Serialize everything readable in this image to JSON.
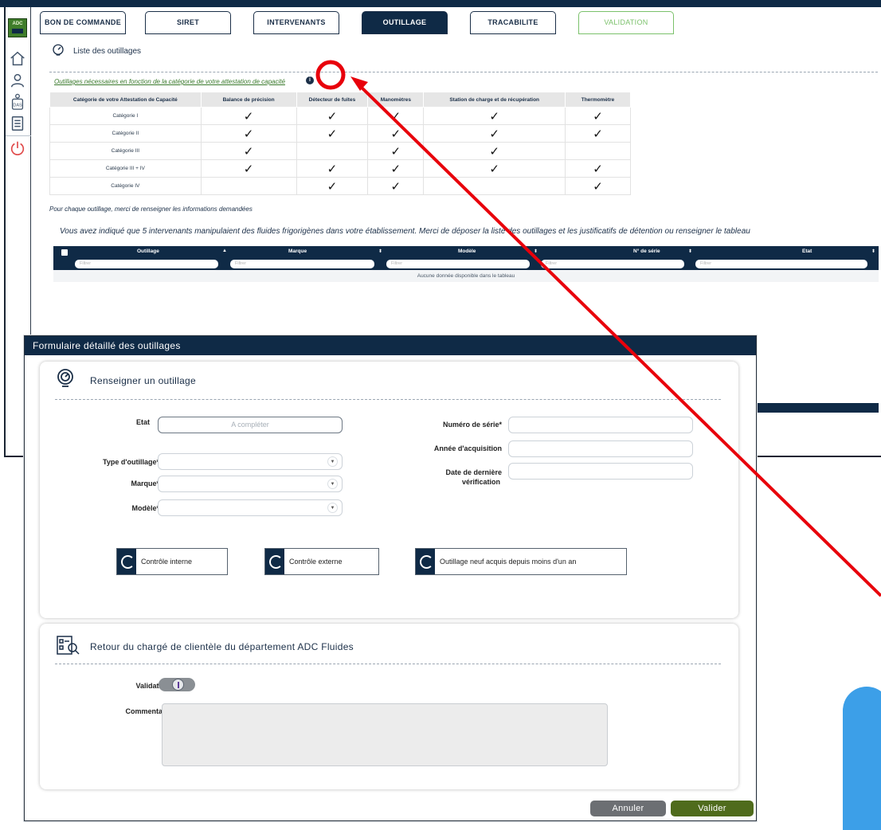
{
  "sidebar": {
    "logo_text": "ADC",
    "items": [
      {
        "name": "home"
      },
      {
        "name": "user"
      },
      {
        "name": "users-bag",
        "badge": "DAS"
      },
      {
        "name": "document"
      },
      {
        "name": "power"
      }
    ]
  },
  "tabs": [
    {
      "label": "BON DE COMMANDE",
      "active": false
    },
    {
      "label": "SIRET",
      "active": false
    },
    {
      "label": "INTERVENANTS",
      "active": false
    },
    {
      "label": "OUTILLAGE",
      "active": true
    },
    {
      "label": "TRACABILITE",
      "active": false
    },
    {
      "label": "VALIDATION",
      "active": false
    }
  ],
  "section": {
    "title": "Liste des outillages",
    "requirement_link": "Outillages nécessaires en fonction de la catégorie de votre attestation de capacité"
  },
  "category_table": {
    "headers": [
      "Catégorie de votre Attestation de Capacité",
      "Balance de précision",
      "Détecteur de fuites",
      "Manomètres",
      "Station de charge et de récupération",
      "Thermomètre"
    ],
    "check_symbol": "✓",
    "rows": [
      {
        "label": "Catégorie I",
        "checks": [
          true,
          true,
          true,
          true,
          true
        ]
      },
      {
        "label": "Catégorie II",
        "checks": [
          true,
          true,
          true,
          true,
          true
        ]
      },
      {
        "label": "Catégorie III",
        "checks": [
          true,
          false,
          true,
          true,
          false
        ]
      },
      {
        "label": "Catégorie III + IV",
        "checks": [
          true,
          true,
          true,
          true,
          true
        ]
      },
      {
        "label": "Catégorie IV",
        "checks": [
          false,
          true,
          true,
          false,
          true
        ]
      }
    ]
  },
  "hint": "Pour chaque outillage, merci de renseigner les informations demandées",
  "message": "Vous avez indiqué que 5 intervenants manipulaient des fluides frigorigènes dans votre établissement. Merci de déposer la liste des outillages et les justificatifs de détention ou renseigner le tableau",
  "grid": {
    "columns": [
      "Outillage",
      "Marque",
      "Modèle",
      "N° de série",
      "Etat"
    ],
    "filter_placeholder": "Filtrer",
    "empty_text": "Aucune donnée disponible dans le tableau"
  },
  "modal": {
    "title": "Formulaire détaillé des outillages",
    "form": {
      "title": "Renseigner un outillage",
      "etat_label": "Etat",
      "etat_value": "A compléter",
      "type_label": "Type d'outillage*",
      "marque_label": "Marque*",
      "modele_label": "Modèle*",
      "serie_label": "Numéro de série*",
      "annee_label": "Année d'acquisition",
      "verif_label_1": "Date de dernière",
      "verif_label_2": "vérification",
      "select_arrow": "▼",
      "toggles": [
        "Contrôle interne",
        "Contrôle externe",
        "Outillage neuf acquis depuis moins d'un an"
      ]
    },
    "feedback": {
      "title": "Retour du chargé de clientèle du département ADC Fluides",
      "validation_label": "Validation",
      "comment_label": "Commentaire"
    },
    "buttons": {
      "cancel": "Annuler",
      "ok": "Valider"
    }
  },
  "colors": {
    "navy": "#0f2a46",
    "green": "#4f6b1c",
    "annotation": "#e8000b",
    "accent_blue": "#3c9fe8"
  }
}
